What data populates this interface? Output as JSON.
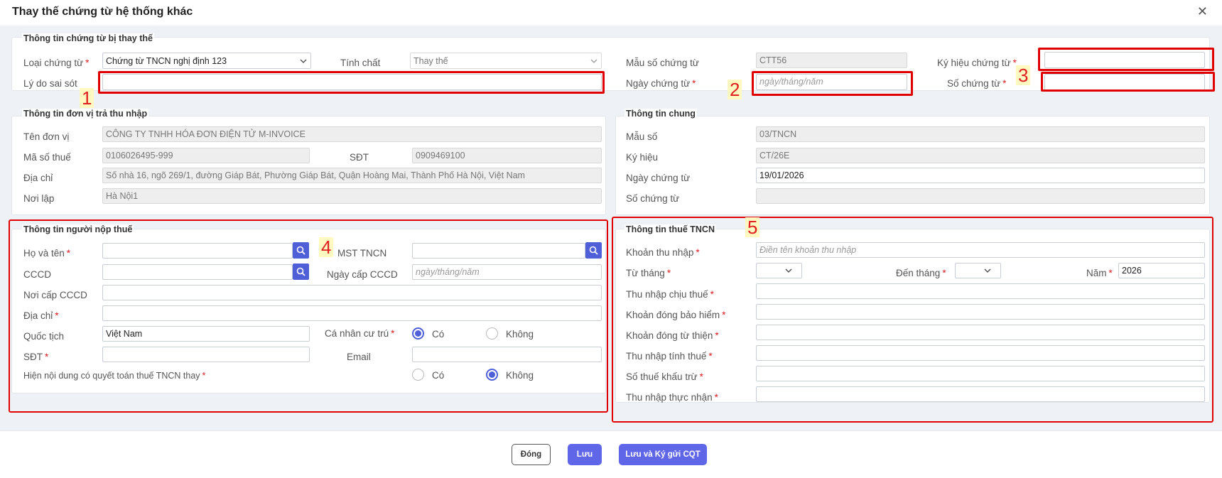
{
  "dialog": {
    "title": "Thay thế chứng từ hệ thống khác"
  },
  "replaced": {
    "title": "Thông tin chứng từ bị thay thế",
    "loai_label": "Loại chứng từ",
    "loai_value": "Chứng từ TNCN nghị định 123",
    "tinhchat_label": "Tính chất",
    "tinhchat_value": "Thay thế",
    "mauso_label": "Mẫu số chứng từ",
    "mauso_value": "CTT56",
    "kyhieu_label": "Ký hiệu chứng từ",
    "lydo_label": "Lý do sai sót",
    "ngay_label": "Ngày chứng từ",
    "ngay_placeholder": "ngày/tháng/năm",
    "so_label": "Số chứng từ"
  },
  "payer": {
    "title": "Thông tin đơn vị trả thu nhập",
    "ten_label": "Tên đơn vị",
    "ten_value": "CÔNG TY TNHH HÓA ĐƠN ĐIỆN TỬ M-INVOICE",
    "mst_label": "Mã số thuế",
    "mst_value": "0106026495-999",
    "sdt_label": "SĐT",
    "sdt_value": "0909469100",
    "diachi_label": "Địa chỉ",
    "diachi_value": "Số nhà 16, ngõ 269/1, đường Giáp Bát, Phường Giáp Bát, Quận Hoàng Mai, Thành Phố Hà Nội, Việt Nam",
    "noilap_label": "Nơi lập",
    "noilap_value": "Hà Nội1"
  },
  "general": {
    "title": "Thông tin chung",
    "mauso_label": "Mẫu số",
    "mauso_value": "03/TNCN",
    "kyhieu_label": "Ký hiệu",
    "kyhieu_value": "CT/26E",
    "ngay_label": "Ngày chứng từ",
    "ngay_value": "19/01/2026",
    "so_label": "Số chứng từ"
  },
  "taxpayer": {
    "title": "Thông tin người nộp thuế",
    "hoten_label": "Họ và tên",
    "mst_label": "MST TNCN",
    "cccd_label": "CCCD",
    "ngaycap_label": "Ngày cấp CCCD",
    "ngaycap_placeholder": "ngày/tháng/năm",
    "noicap_label": "Nơi cấp CCCD",
    "diachi_label": "Địa chỉ",
    "quoctich_label": "Quốc tịch",
    "quoctich_value": "Việt Nam",
    "cutru_label": "Cá nhân cư trú",
    "co_label": "Có",
    "khong_label": "Không",
    "sdt_label": "SĐT",
    "email_label": "Email",
    "hien_label": "Hiện nội dung có quyết toán thuế TNCN thay",
    "co2_label": "Có",
    "khong2_label": "Không"
  },
  "tax": {
    "title": "Thông tin thuế TNCN",
    "khoan_label": "Khoản thu nhập",
    "khoan_placeholder": "Điền tên khoản thu nhập",
    "tuthang_label": "Từ tháng",
    "denthang_label": "Đến tháng",
    "nam_label": "Năm",
    "nam_value": "2026",
    "tnct_label": "Thu nhập chịu thuế",
    "baohiem_label": "Khoản đóng bảo hiểm",
    "tuthien_label": "Khoản đóng từ thiện",
    "tntt_label": "Thu nhập tính thuế",
    "khautru_label": "Số thuế khấu trừ",
    "thucnhan_label": "Thu nhập thực nhận"
  },
  "annotations": [
    "1",
    "2",
    "3",
    "4",
    "5"
  ],
  "footer": {
    "close_label": "Đóng",
    "save_label": "Lưu",
    "save_sign_label": "Lưu và Ký gửi CQT"
  },
  "colors": {
    "accent": "#4f5fd8",
    "required": "#d62020",
    "highlight": "#e00000"
  }
}
